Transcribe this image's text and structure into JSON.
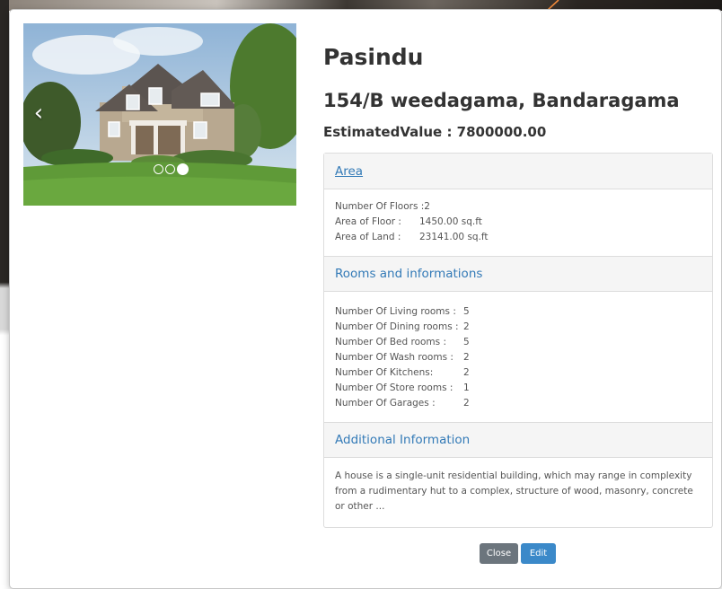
{
  "colors": {
    "link": "#337ab7",
    "close_button": "#6c757d",
    "edit_button": "#3b89c9",
    "annotation_arrow": "#f08a3c"
  },
  "carousel": {
    "prev_glyph": "‹",
    "slides": 3,
    "active_index": 2
  },
  "property": {
    "owner": "Pasindu",
    "address": "154/B weedagama, Bandaragama",
    "estimate_text": "EstimatedValue : 7800000.00"
  },
  "area": {
    "title": "Area",
    "rows": [
      {
        "label": "Number Of Floors :",
        "value": "2"
      },
      {
        "label": "Area of Floor :",
        "value": "1450.00 sq.ft"
      },
      {
        "label": "Area of Land :",
        "value": "23141.00 sq.ft"
      }
    ]
  },
  "rooms": {
    "title": "Rooms and informations",
    "rows": [
      {
        "label": "Number Of Living rooms :",
        "value": "5"
      },
      {
        "label": "Number Of Dining rooms :",
        "value": "2"
      },
      {
        "label": "Number Of Bed rooms :",
        "value": "5"
      },
      {
        "label": "Number Of Wash rooms :",
        "value": "2"
      },
      {
        "label": "Number Of Kitchens:",
        "value": "2"
      },
      {
        "label": "Number Of Store rooms :",
        "value": "1"
      },
      {
        "label": "Number Of Garages :",
        "value": "2"
      }
    ]
  },
  "additional": {
    "title": "Additional Information",
    "text": "A house is a single-unit residential building, which may range in complexity from a rudimentary hut to a complex, structure of wood, masonry, concrete or other ..."
  },
  "buttons": {
    "close": "Close",
    "edit": "Edit"
  }
}
